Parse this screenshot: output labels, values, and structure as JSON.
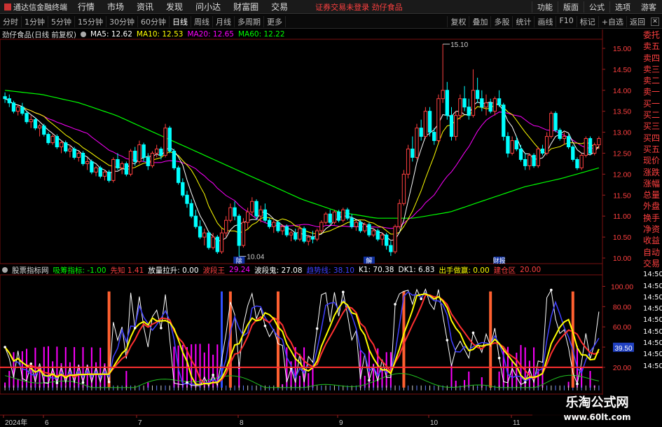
{
  "app": {
    "title": "通达信金融终端",
    "menu": [
      "行情",
      "市场",
      "资讯",
      "发现",
      "问小达",
      "财富圈",
      "交易"
    ],
    "notice": "证券交易未登录  劲仔食品",
    "right_menu": [
      "功能",
      "版面",
      "公式",
      "选项"
    ],
    "guest": "游客"
  },
  "toolbar": {
    "periods": [
      "分时",
      "1分钟",
      "5分钟",
      "15分钟",
      "30分钟",
      "60分钟",
      "日线",
      "周线",
      "月线",
      "多周期",
      "更多"
    ],
    "active_period": "日线",
    "tools": [
      "复权",
      "叠加",
      "多股",
      "统计",
      "画线",
      "F10",
      "标记",
      "+自选",
      "返回"
    ]
  },
  "main_header": {
    "name": "劲仔食品(日线 前复权)",
    "ma": [
      {
        "label": "MA5: 12.62",
        "color": "#ffffff"
      },
      {
        "label": "MA10: 12.53",
        "color": "#ffff00"
      },
      {
        "label": "MA20: 12.65",
        "color": "#ff00ff"
      },
      {
        "label": "MA60: 12.22",
        "color": "#00ff00"
      }
    ]
  },
  "sub_header": {
    "name": "股票指标网",
    "items": [
      {
        "label": "吸筹指标: -1.00",
        "color": "#00ff00"
      },
      {
        "label": "先知 1.41",
        "color": "#ff4040"
      },
      {
        "label": "放量拉升: 0.00",
        "color": "#ffffff"
      },
      {
        "label": "波段王",
        "color": "#ff4040"
      },
      {
        "label": "29.24",
        "color": "#ff00ff"
      },
      {
        "label": "波段鬼: 27.08",
        "color": "#ffffff"
      },
      {
        "label": "趋势线: 38.10",
        "color": "#4040ff"
      },
      {
        "label": "K1: 70.38",
        "color": "#ffffff"
      },
      {
        "label": "DK1: 6.83",
        "color": "#ffffff"
      },
      {
        "label": "出手做赢: 0.00",
        "color": "#ffff00"
      },
      {
        "label": "建仓区",
        "color": "#ff4040"
      },
      {
        "label": "20.00",
        "color": "#ff4040"
      }
    ]
  },
  "side_panel": [
    "委托",
    "卖五",
    "卖四",
    "卖三",
    "卖二",
    "卖一",
    "买一",
    "买二",
    "买三",
    "买四",
    "买五",
    "现价",
    "涨跌",
    "涨幅",
    "总量",
    "外盘",
    "换手",
    "净资",
    "收益",
    "自动",
    "交易",
    "14:50",
    "14:50",
    "14:50",
    "14:50",
    "14:50",
    "14:50",
    "14:50",
    "14:50",
    "14:50"
  ],
  "chart_data": [
    {
      "type": "candlestick",
      "ylim": [
        9.9,
        15.2
      ],
      "yticks": [
        "15.00",
        "14.50",
        "14.00",
        "13.50",
        "13.00",
        "12.50",
        "12.00",
        "11.50",
        "11.00",
        "10.50",
        "10.00"
      ],
      "ytick_values": [
        15.0,
        14.5,
        14.0,
        13.5,
        13.0,
        12.5,
        12.0,
        11.5,
        11.0,
        10.5,
        10.0
      ],
      "annotations": [
        {
          "text": "15.10",
          "index": 101,
          "price": 15.1
        },
        {
          "text": "10.04",
          "index": 54,
          "price": 10.04
        }
      ],
      "event_markers": [
        {
          "text": "除",
          "index": 54
        },
        {
          "text": "解",
          "index": 84
        },
        {
          "text": "财报",
          "index": 114
        }
      ],
      "colors": {
        "up": "#ff4040",
        "down": "#00ffff",
        "ma5": "#ffffff",
        "ma10": "#ffff00",
        "ma20": "#ff00ff",
        "ma60": "#00ff00"
      },
      "candles": [
        [
          13.85,
          13.95,
          13.7,
          13.8
        ],
        [
          13.8,
          13.9,
          13.6,
          13.7
        ],
        [
          13.7,
          13.75,
          13.45,
          13.5
        ],
        [
          13.5,
          13.65,
          13.4,
          13.6
        ],
        [
          13.6,
          13.7,
          13.4,
          13.45
        ],
        [
          13.45,
          13.5,
          13.2,
          13.25
        ],
        [
          13.25,
          13.4,
          13.1,
          13.3
        ],
        [
          13.3,
          13.35,
          13.05,
          13.1
        ],
        [
          13.1,
          13.2,
          12.9,
          13.15
        ],
        [
          13.15,
          13.2,
          12.9,
          12.95
        ],
        [
          12.95,
          13.0,
          12.7,
          12.75
        ],
        [
          12.75,
          12.95,
          12.7,
          12.9
        ],
        [
          12.9,
          12.95,
          12.6,
          12.65
        ],
        [
          12.65,
          12.8,
          12.5,
          12.75
        ],
        [
          12.75,
          12.8,
          12.5,
          12.55
        ],
        [
          12.55,
          12.7,
          12.4,
          12.6
        ],
        [
          12.6,
          12.65,
          12.35,
          12.4
        ],
        [
          12.4,
          12.55,
          12.3,
          12.5
        ],
        [
          12.5,
          12.55,
          12.2,
          12.25
        ],
        [
          12.25,
          12.4,
          12.1,
          12.3
        ],
        [
          12.3,
          12.35,
          12.0,
          12.05
        ],
        [
          12.05,
          12.2,
          11.95,
          12.15
        ],
        [
          12.15,
          12.2,
          11.9,
          11.95
        ],
        [
          11.95,
          12.1,
          11.85,
          12.05
        ],
        [
          12.05,
          12.1,
          11.8,
          11.85
        ],
        [
          11.85,
          12.4,
          11.8,
          12.35
        ],
        [
          12.35,
          12.5,
          12.1,
          12.15
        ],
        [
          12.15,
          12.3,
          12.0,
          12.25
        ],
        [
          12.25,
          12.3,
          11.95,
          12.0
        ],
        [
          12.0,
          12.6,
          11.95,
          12.55
        ],
        [
          12.55,
          12.65,
          12.2,
          12.3
        ],
        [
          12.3,
          12.8,
          12.25,
          12.7
        ],
        [
          12.7,
          12.75,
          12.3,
          12.4
        ],
        [
          12.4,
          12.5,
          12.1,
          12.2
        ],
        [
          12.2,
          12.55,
          12.15,
          12.5
        ],
        [
          12.5,
          12.7,
          12.4,
          12.6
        ],
        [
          12.6,
          12.65,
          12.35,
          12.45
        ],
        [
          12.45,
          13.2,
          12.4,
          13.1
        ],
        [
          13.1,
          13.15,
          12.5,
          12.55
        ],
        [
          12.55,
          12.6,
          12.1,
          12.15
        ],
        [
          12.15,
          12.2,
          11.75,
          11.8
        ],
        [
          11.8,
          11.9,
          11.45,
          11.5
        ],
        [
          11.5,
          11.6,
          11.2,
          11.3
        ],
        [
          11.3,
          11.4,
          10.95,
          11.0
        ],
        [
          11.0,
          11.15,
          10.7,
          10.75
        ],
        [
          10.75,
          10.9,
          10.45,
          10.5
        ],
        [
          10.5,
          10.7,
          10.3,
          10.6
        ],
        [
          10.6,
          10.65,
          10.2,
          10.25
        ],
        [
          10.25,
          10.6,
          10.2,
          10.5
        ],
        [
          10.5,
          10.55,
          10.1,
          10.15
        ],
        [
          10.15,
          10.7,
          10.1,
          10.6
        ],
        [
          10.6,
          11.0,
          10.5,
          10.9
        ],
        [
          10.9,
          11.3,
          10.85,
          11.2
        ],
        [
          11.2,
          11.35,
          10.9,
          11.0
        ],
        [
          11.0,
          11.05,
          10.04,
          10.3
        ],
        [
          10.3,
          10.95,
          10.25,
          10.85
        ],
        [
          10.85,
          11.2,
          10.7,
          11.1
        ],
        [
          11.1,
          11.45,
          11.0,
          11.35
        ],
        [
          11.35,
          11.4,
          10.9,
          11.0
        ],
        [
          11.0,
          11.25,
          10.85,
          11.15
        ],
        [
          11.15,
          11.3,
          10.85,
          10.9
        ],
        [
          10.9,
          10.95,
          10.7,
          10.75
        ],
        [
          10.75,
          10.9,
          10.6,
          10.85
        ],
        [
          10.85,
          10.9,
          10.6,
          10.65
        ],
        [
          10.65,
          10.8,
          10.55,
          10.75
        ],
        [
          10.75,
          10.8,
          10.5,
          10.55
        ],
        [
          10.55,
          10.65,
          10.4,
          10.6
        ],
        [
          10.6,
          10.7,
          10.4,
          10.45
        ],
        [
          10.45,
          10.8,
          10.4,
          10.7
        ],
        [
          10.7,
          10.75,
          10.35,
          10.4
        ],
        [
          10.4,
          10.55,
          10.3,
          10.5
        ],
        [
          10.5,
          10.65,
          10.35,
          10.45
        ],
        [
          10.45,
          10.7,
          10.4,
          10.65
        ],
        [
          10.65,
          10.9,
          10.6,
          10.85
        ],
        [
          10.85,
          11.1,
          10.8,
          11.05
        ],
        [
          11.05,
          11.15,
          10.8,
          10.85
        ],
        [
          10.85,
          11.15,
          10.8,
          11.1
        ],
        [
          11.1,
          11.15,
          10.85,
          10.9
        ],
        [
          10.9,
          11.2,
          10.85,
          11.15
        ],
        [
          11.15,
          11.2,
          10.9,
          10.95
        ],
        [
          10.95,
          11.05,
          10.7,
          10.75
        ],
        [
          10.75,
          10.9,
          10.65,
          10.85
        ],
        [
          10.85,
          10.9,
          10.6,
          10.65
        ],
        [
          10.65,
          10.85,
          10.6,
          10.8
        ],
        [
          10.8,
          10.85,
          10.5,
          10.55
        ],
        [
          10.55,
          10.7,
          10.5,
          10.65
        ],
        [
          10.65,
          10.7,
          10.4,
          10.45
        ],
        [
          10.45,
          10.6,
          10.3,
          10.55
        ],
        [
          10.55,
          10.6,
          10.2,
          10.3
        ],
        [
          10.3,
          10.4,
          10.05,
          10.15
        ],
        [
          10.15,
          10.8,
          10.1,
          10.75
        ],
        [
          10.75,
          11.4,
          10.7,
          11.3
        ],
        [
          11.3,
          12.1,
          11.25,
          12.0
        ],
        [
          12.0,
          12.7,
          11.9,
          12.6
        ],
        [
          12.6,
          12.9,
          12.3,
          12.4
        ],
        [
          12.4,
          13.2,
          12.35,
          13.1
        ],
        [
          13.1,
          13.3,
          12.8,
          12.9
        ],
        [
          12.9,
          13.6,
          12.85,
          13.5
        ],
        [
          13.5,
          13.6,
          12.9,
          13.0
        ],
        [
          13.0,
          13.1,
          12.7,
          12.8
        ],
        [
          12.8,
          13.9,
          12.75,
          13.8
        ],
        [
          13.8,
          15.1,
          13.7,
          14.0
        ],
        [
          14.0,
          14.2,
          13.3,
          13.4
        ],
        [
          13.4,
          13.6,
          12.8,
          12.9
        ],
        [
          12.9,
          13.5,
          12.8,
          13.4
        ],
        [
          13.4,
          13.9,
          13.3,
          13.8
        ],
        [
          13.8,
          14.1,
          13.5,
          13.6
        ],
        [
          13.6,
          13.8,
          13.3,
          13.4
        ],
        [
          13.4,
          14.5,
          13.35,
          14.0
        ],
        [
          14.0,
          14.3,
          13.7,
          13.8
        ],
        [
          13.8,
          14.0,
          13.5,
          13.6
        ],
        [
          13.6,
          13.9,
          13.4,
          13.7
        ],
        [
          13.7,
          13.8,
          13.45,
          13.5
        ],
        [
          13.5,
          13.85,
          13.4,
          13.8
        ],
        [
          13.8,
          14.0,
          13.6,
          13.65
        ],
        [
          13.65,
          13.7,
          12.8,
          12.9
        ],
        [
          12.9,
          13.0,
          12.4,
          12.5
        ],
        [
          12.5,
          12.9,
          12.45,
          12.8
        ],
        [
          12.8,
          12.9,
          12.55,
          12.6
        ],
        [
          12.6,
          12.7,
          12.3,
          12.35
        ],
        [
          12.35,
          12.5,
          12.1,
          12.2
        ],
        [
          12.2,
          12.5,
          12.1,
          12.45
        ],
        [
          12.45,
          12.5,
          12.15,
          12.2
        ],
        [
          12.2,
          12.65,
          12.15,
          12.6
        ],
        [
          12.6,
          12.7,
          12.45,
          12.5
        ],
        [
          12.5,
          13.0,
          12.45,
          12.9
        ],
        [
          12.9,
          13.5,
          12.85,
          13.45
        ],
        [
          13.45,
          13.5,
          13.0,
          13.05
        ],
        [
          13.05,
          13.1,
          12.8,
          12.85
        ],
        [
          12.85,
          13.0,
          12.7,
          12.9
        ],
        [
          12.9,
          12.95,
          12.6,
          12.65
        ],
        [
          12.65,
          12.7,
          12.3,
          12.35
        ],
        [
          12.35,
          12.4,
          12.1,
          12.15
        ],
        [
          12.15,
          12.5,
          12.1,
          12.45
        ],
        [
          12.45,
          12.9,
          12.4,
          12.85
        ],
        [
          12.85,
          12.9,
          12.45,
          12.5
        ],
        [
          12.5,
          12.75,
          12.45,
          12.7
        ],
        [
          12.7,
          12.9,
          12.6,
          12.85
        ]
      ]
    },
    {
      "type": "line",
      "title": "股票指标网",
      "ylim": [
        -5,
        110
      ],
      "yticks": [
        "100.00",
        "80.00",
        "60.00",
        "40.00",
        "20.00"
      ],
      "ytick_values": [
        100,
        80,
        60,
        40,
        20
      ],
      "current_marker": "39.50",
      "series": [
        {
          "name": "波段王",
          "color": "#ff00ff",
          "type": "bar"
        },
        {
          "name": "波段鬼",
          "color": "#ffffff",
          "type": "line"
        },
        {
          "name": "趋势线",
          "color": "#4040ff",
          "type": "line"
        },
        {
          "name": "K1",
          "color": "#ffffff",
          "type": "line"
        },
        {
          "name": "出手做赢",
          "color": "#ffff00",
          "type": "line"
        },
        {
          "name": "建仓区",
          "color": "#ff4040",
          "type": "hline",
          "value": 20
        }
      ]
    }
  ],
  "bottom_axis": [
    "2024年",
    "6",
    "7",
    "8",
    "9",
    "10",
    "11"
  ],
  "watermark": {
    "line1": "乐淘公式网",
    "line2": "www.60lt.com"
  }
}
